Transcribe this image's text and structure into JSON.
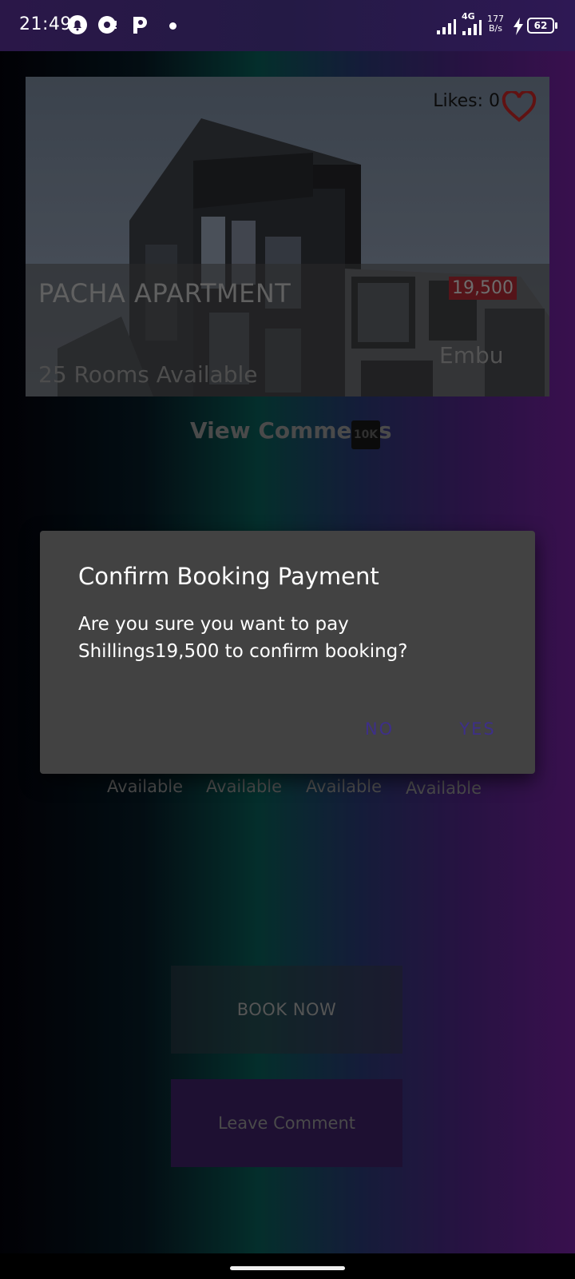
{
  "status_bar": {
    "time": "21:49",
    "network_type": "4G",
    "speed_value": "177",
    "speed_unit": "B/s",
    "battery": "62",
    "icons": [
      "notification-bell-icon",
      "app-icon",
      "p-icon",
      "dot-icon",
      "signal-icon",
      "signal-4g-icon",
      "charging-icon",
      "battery-icon"
    ]
  },
  "property": {
    "likes_label": "Likes: 0",
    "name": "PACHA APARTMENT",
    "price": "19,500",
    "location": "Embu",
    "rooms": "25 Rooms Available"
  },
  "comments": {
    "link_label": "View Comments",
    "count_badge": "10K"
  },
  "availability": [
    "Available",
    "Available",
    "Available",
    "Available"
  ],
  "actions": {
    "book_label": "BOOK NOW",
    "comment_label": "Leave Comment"
  },
  "dialog": {
    "title": "Confirm Booking Payment",
    "message": "Are you sure you want to pay Shillings19,500 to confirm booking?",
    "negative_label": "NO",
    "positive_label": "YES"
  },
  "colors": {
    "dialog_bg": "#424242",
    "dialog_button_text": "#3d2f88",
    "price_badge_bg": "#7a1e24",
    "heart": "#8b1a1a"
  }
}
